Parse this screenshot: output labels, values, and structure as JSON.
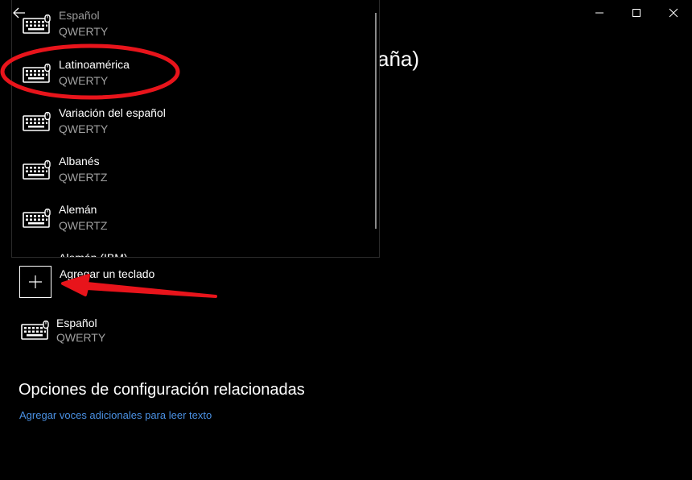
{
  "window": {
    "controls": {
      "minimize_icon": "minimize-icon",
      "maximize_icon": "maximize-icon",
      "close_icon": "close-icon"
    }
  },
  "header": {
    "back_icon": "back-arrow-icon",
    "title_partial": "aña)"
  },
  "flyout": {
    "items": [
      {
        "name": "Español",
        "layout": "QWERTY"
      },
      {
        "name": "Latinoamérica",
        "layout": "QWERTY"
      },
      {
        "name": "Variación del español",
        "layout": "QWERTY"
      },
      {
        "name": "Albanés",
        "layout": "QWERTZ"
      },
      {
        "name": "Alemán",
        "layout": "QWERTZ"
      },
      {
        "name": "Alemán (IBM)",
        "layout": ""
      }
    ]
  },
  "keyboards": {
    "add_label": "Agregar un teclado",
    "installed": [
      {
        "name": "Español",
        "layout": "QWERTY"
      }
    ]
  },
  "related": {
    "title": "Opciones de configuración relacionadas",
    "link": "Agregar voces adicionales para leer texto"
  },
  "colors": {
    "background": "#000000",
    "link": "#4a90e2",
    "annotation": "#e8141b",
    "secondary_text": "#a0a0a0"
  }
}
